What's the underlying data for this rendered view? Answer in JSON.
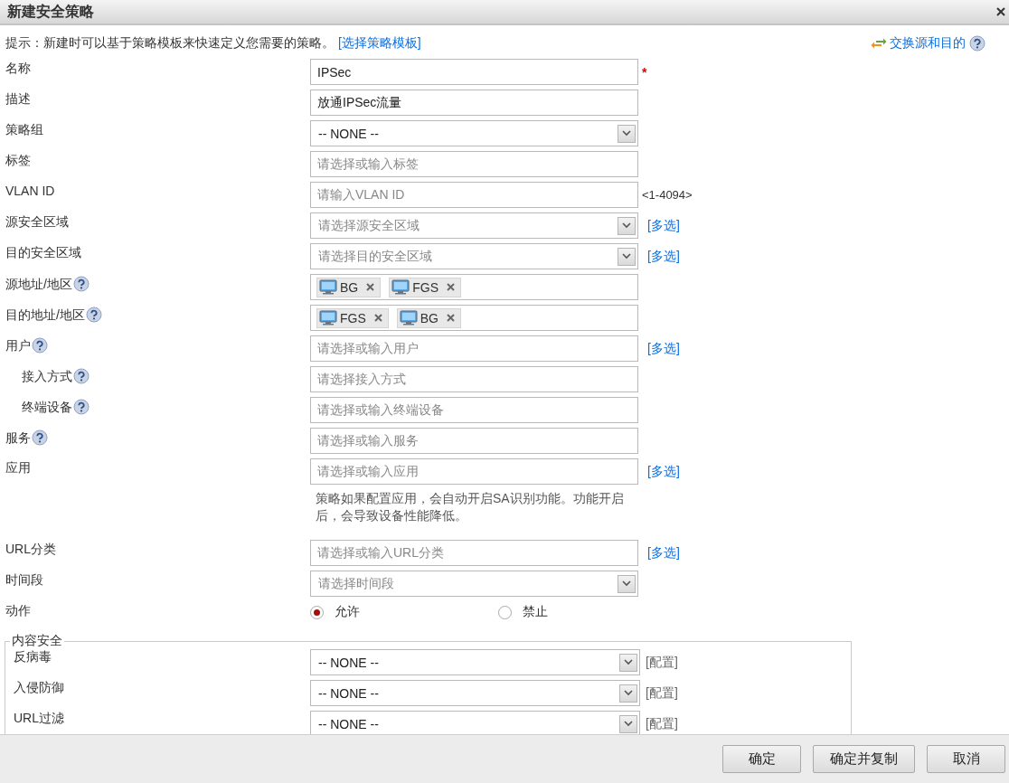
{
  "window": {
    "title": "新建安全策略"
  },
  "hint": {
    "text": "提示：新建时可以基于策略模板来快速定义您需要的策略。",
    "link": "[选择策略模板]"
  },
  "swap_link": "交换源和目的",
  "fields": [
    {
      "label": "名称",
      "kind": "text",
      "value": "IPSec",
      "required_mark": "*"
    },
    {
      "label": "描述",
      "kind": "text",
      "value": "放通IPSec流量"
    },
    {
      "label": "策略组",
      "kind": "select",
      "value": "-- NONE --"
    },
    {
      "label": "标签",
      "kind": "text",
      "placeholder": "请选择或输入标签"
    },
    {
      "label": "VLAN ID",
      "kind": "text",
      "placeholder": "请输入VLAN ID",
      "range": "<1-4094>"
    },
    {
      "label": "源安全区域",
      "kind": "select",
      "placeholder": "请选择源安全区域",
      "link": "[多选]"
    },
    {
      "label": "目的安全区域",
      "kind": "select",
      "placeholder": "请选择目的安全区域",
      "link": "[多选]"
    },
    {
      "label": "源地址/地区",
      "help": true,
      "kind": "tags",
      "tags": [
        "BG",
        "FGS"
      ]
    },
    {
      "label": "目的地址/地区",
      "help": true,
      "kind": "tags",
      "tags": [
        "FGS",
        "BG"
      ]
    },
    {
      "label": "用户",
      "help": true,
      "kind": "text",
      "placeholder": "请选择或输入用户",
      "link": "[多选]",
      "children": [
        {
          "label": "接入方式",
          "help": true,
          "kind": "text",
          "placeholder": "请选择接入方式"
        },
        {
          "label": "终端设备",
          "help": true,
          "kind": "text",
          "placeholder": "请选择或输入终端设备"
        }
      ]
    },
    {
      "label": "服务",
      "help": true,
      "kind": "text",
      "placeholder": "请选择或输入服务"
    },
    {
      "label": "应用",
      "kind": "text",
      "placeholder": "请选择或输入应用",
      "link": "[多选]",
      "note": "策略如果配置应用，会自动开启SA识别功能。功能开启后，会导致设备性能降低。"
    },
    {
      "label": "URL分类",
      "kind": "text",
      "placeholder": "请选择或输入URL分类",
      "link": "[多选]"
    },
    {
      "label": "时间段",
      "kind": "select",
      "placeholder": "请选择时间段"
    },
    {
      "label": "动作",
      "kind": "radio",
      "options": [
        {
          "label": "允许",
          "selected": true
        },
        {
          "label": "禁止",
          "selected": false
        }
      ]
    }
  ],
  "content_security": {
    "title": "内容安全",
    "rows": [
      {
        "label": "反病毒",
        "value": "-- NONE --",
        "link": "[配置]"
      },
      {
        "label": "入侵防御",
        "value": "-- NONE --",
        "link": "[配置]"
      },
      {
        "label": "URL过滤",
        "value": "-- NONE --",
        "link": "[配置]"
      }
    ]
  },
  "buttons": [
    "确定",
    "确定并复制",
    "取消"
  ]
}
